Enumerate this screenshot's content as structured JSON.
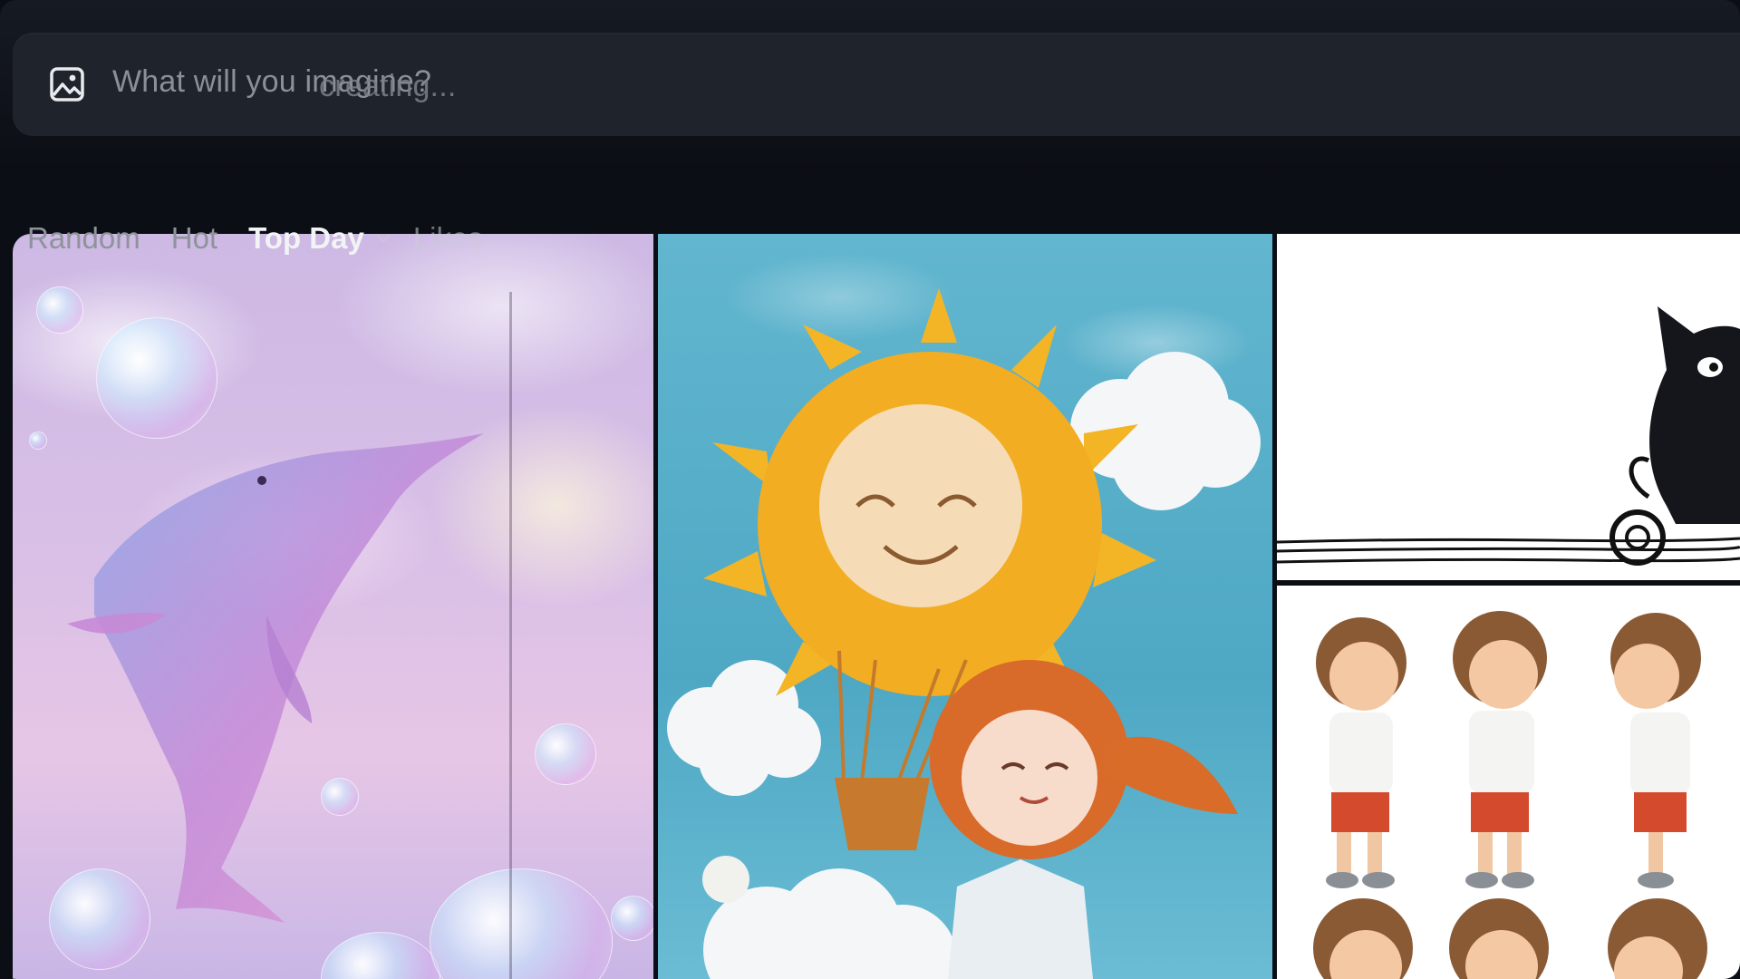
{
  "prompt": {
    "placeholder": "What will you imagine?",
    "secondary_placeholder": "creating...",
    "icon": "image-icon"
  },
  "tabs": [
    {
      "label": "Random"
    },
    {
      "label": "Hot"
    },
    {
      "label": "Top Day",
      "selected": true
    },
    {
      "label": "Likes"
    }
  ],
  "gallery": [
    {
      "subject": "pastel dolphin with bubbles"
    },
    {
      "subject": "felt sun hot-air balloon with doll"
    },
    {
      "subject": "black scribble cat"
    },
    {
      "subject": "cartoon boy character turnaround"
    }
  ],
  "colors": {
    "background": "#0b0e14",
    "prompt_bar": "#1f232b",
    "tab_active": "#f2f3f5",
    "tab_inactive": "#8e939c"
  }
}
